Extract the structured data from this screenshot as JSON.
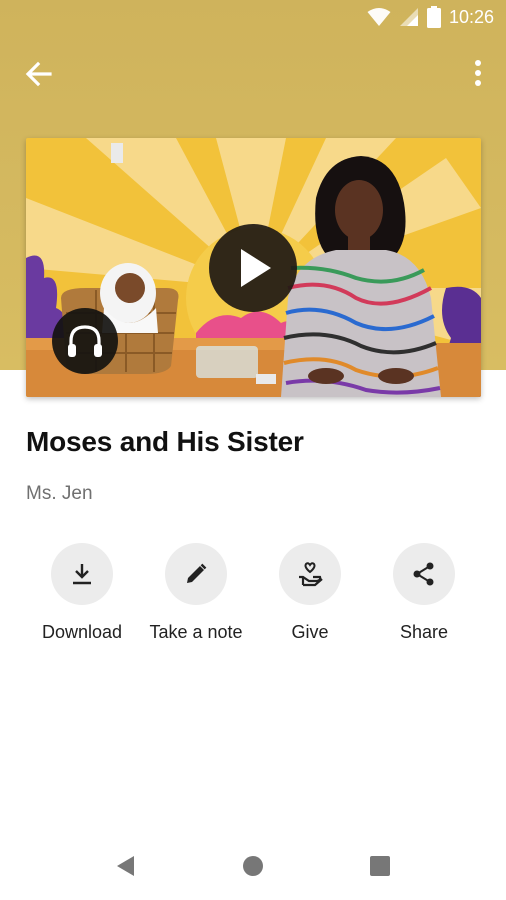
{
  "status_bar": {
    "time": "10:26"
  },
  "content": {
    "title": "Moses and His Sister",
    "speaker": "Ms. Jen"
  },
  "actions": [
    {
      "label": "Download",
      "icon": "download-icon"
    },
    {
      "label": "Take a note",
      "icon": "pencil-icon"
    },
    {
      "label": "Give",
      "icon": "give-heart-hand-icon"
    },
    {
      "label": "Share",
      "icon": "share-icon"
    }
  ],
  "colors": {
    "hero_background": "#d4b95f",
    "action_circle": "#ececec",
    "speaker_text": "#707070"
  }
}
